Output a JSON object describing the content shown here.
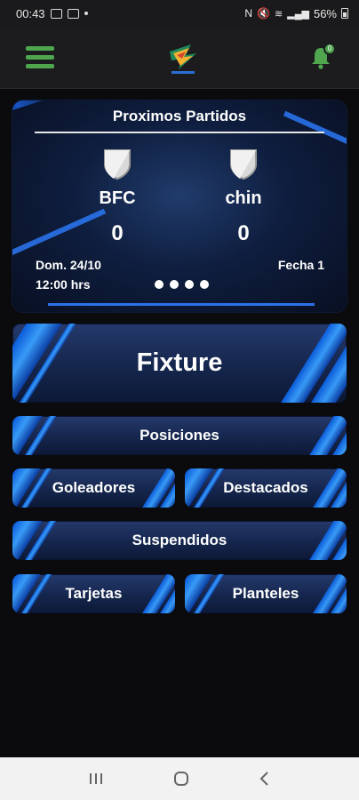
{
  "status_bar": {
    "time": "00:43",
    "battery": "56%"
  },
  "app_bar": {
    "notifications_badge": "0",
    "accent_color": "#4fa64f"
  },
  "next_matches": {
    "title": "Proximos Partidos",
    "home_team": "BFC",
    "away_team": "chin",
    "home_score": "0",
    "away_score": "0",
    "date": "Dom. 24/10",
    "time": "12:00 hrs",
    "round": "Fecha 1",
    "pages": 4
  },
  "menu": {
    "fixture": "Fixture",
    "posiciones": "Posiciones",
    "goleadores": "Goleadores",
    "destacados": "Destacados",
    "suspendidos": "Suspendidos",
    "tarjetas": "Tarjetas",
    "planteles": "Planteles"
  }
}
